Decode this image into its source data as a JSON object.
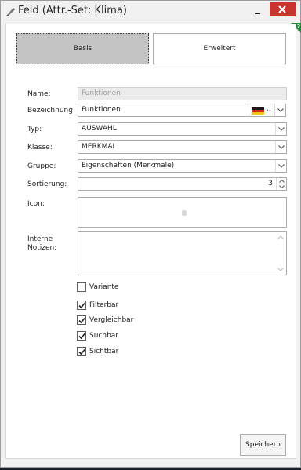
{
  "window": {
    "title": "Feld (Attr.-Set: Klima)",
    "accent_close": "#c7362e",
    "help_color": "#1f8a3c"
  },
  "tabs": {
    "basis": "Basis",
    "erweitert": "Erweitert",
    "active": "Basis"
  },
  "form": {
    "name_label": "Name:",
    "name_value": "Funktionen",
    "bezeichnung_label": "Bezeichnung:",
    "bezeichnung_value": "Funktionen",
    "language_flag": "german-flag-icon",
    "language_more": "..",
    "typ_label": "Typ:",
    "typ_value": "AUSWAHL",
    "klasse_label": "Klasse:",
    "klasse_value": "MERKMAL",
    "gruppe_label": "Gruppe:",
    "gruppe_value": "Eigenschaften (Merkmale)",
    "sortierung_label": "Sortierung:",
    "sortierung_value": "3",
    "icon_label": "Icon:",
    "notizen_label_1": "Interne",
    "notizen_label_2": "Notizen:"
  },
  "checkboxes": [
    {
      "label": "Variante",
      "checked": false
    },
    {
      "label": "Filterbar",
      "checked": true
    },
    {
      "label": "Vergleichbar",
      "checked": true
    },
    {
      "label": "Suchbar",
      "checked": true
    },
    {
      "label": "Sichtbar",
      "checked": true
    }
  ],
  "actions": {
    "save_label": "Speichern"
  }
}
